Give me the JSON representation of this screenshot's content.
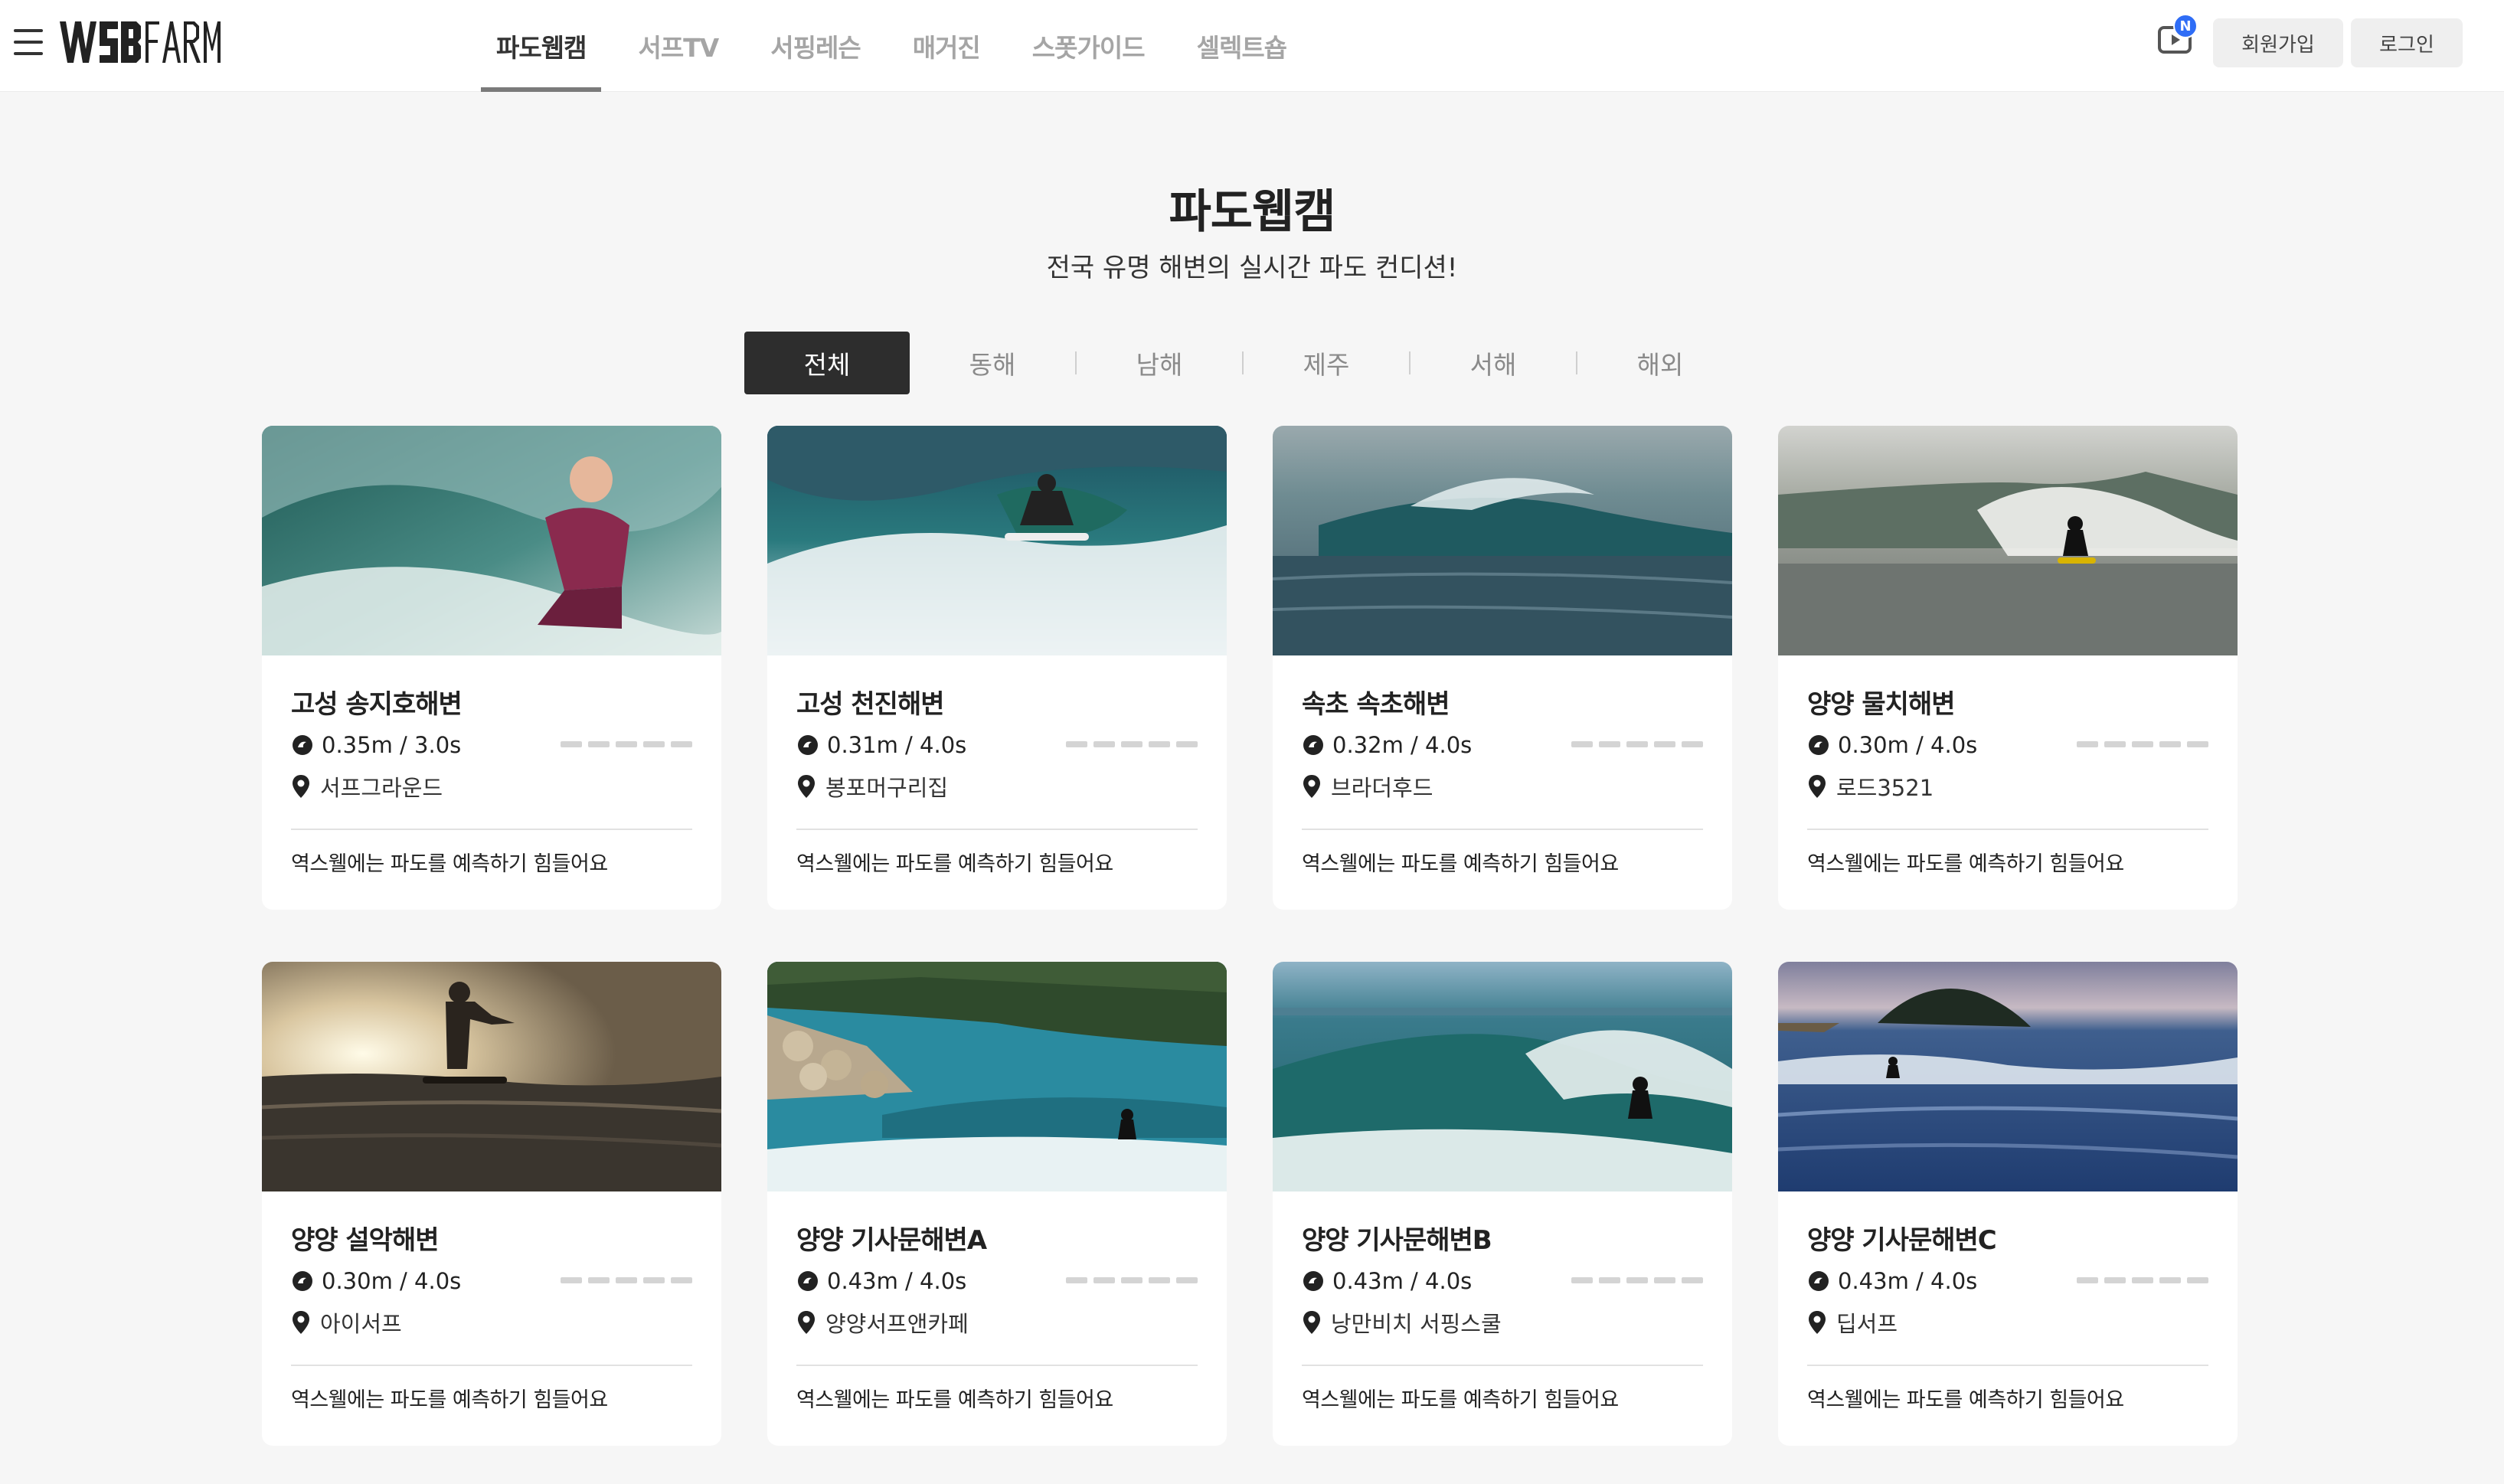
{
  "header": {
    "logo_text": "WSB FARM",
    "nav": [
      {
        "label": "파도웹캠",
        "active": true
      },
      {
        "label": "서프TV",
        "active": false
      },
      {
        "label": "서핑레슨",
        "active": false
      },
      {
        "label": "매거진",
        "active": false
      },
      {
        "label": "스폿가이드",
        "active": false
      },
      {
        "label": "셀렉트숍",
        "active": false
      }
    ],
    "tv_badge": "N",
    "signup_label": "회원가입",
    "login_label": "로그인"
  },
  "main": {
    "title": "파도웹캠",
    "subtitle": "전국 유명 해변의 실시간 파도 컨디션!",
    "tabs": [
      {
        "label": "전체",
        "active": true
      },
      {
        "label": "동해",
        "active": false
      },
      {
        "label": "남해",
        "active": false
      },
      {
        "label": "제주",
        "active": false
      },
      {
        "label": "서해",
        "active": false
      },
      {
        "label": "해외",
        "active": false
      }
    ],
    "cards": [
      {
        "title": "고성 송지호해변",
        "wave": "0.35m / 3.0s",
        "location": "서프그라운드",
        "note": "역스웰에는 파도를 예측하기 힘들어요",
        "rating": 0
      },
      {
        "title": "고성 천진해변",
        "wave": "0.31m / 4.0s",
        "location": "봉포머구리집",
        "note": "역스웰에는 파도를 예측하기 힘들어요",
        "rating": 0
      },
      {
        "title": "속초 속초해변",
        "wave": "0.32m / 4.0s",
        "location": "브라더후드",
        "note": "역스웰에는 파도를 예측하기 힘들어요",
        "rating": 0
      },
      {
        "title": "양양 물치해변",
        "wave": "0.30m / 4.0s",
        "location": "로드3521",
        "note": "역스웰에는 파도를 예측하기 힘들어요",
        "rating": 0
      },
      {
        "title": "양양 설악해변",
        "wave": "0.30m / 4.0s",
        "location": "아이서프",
        "note": "역스웰에는 파도를 예측하기 힘들어요",
        "rating": 0
      },
      {
        "title": "양양 기사문해변A",
        "wave": "0.43m / 4.0s",
        "location": "양양서프앤카페",
        "note": "역스웰에는 파도를 예측하기 힘들어요",
        "rating": 0
      },
      {
        "title": "양양 기사문해변B",
        "wave": "0.43m / 4.0s",
        "location": "낭만비치 서핑스쿨",
        "note": "역스웰에는 파도를 예측하기 힘들어요",
        "rating": 0
      },
      {
        "title": "양양 기사문해변C",
        "wave": "0.43m / 4.0s",
        "location": "딥서프",
        "note": "역스웰에는 파도를 예측하기 힘들어요",
        "rating": 0
      }
    ]
  },
  "colors": {
    "accent": "#2d2d2d",
    "badge": "#2f6df6",
    "rating_empty": "#d4d4d4",
    "page_bg": "#f6f6f6"
  },
  "icons": {
    "menu": "hamburger-icon",
    "tv": "tv-icon",
    "wave": "wave-icon",
    "location": "location-pin-icon"
  }
}
